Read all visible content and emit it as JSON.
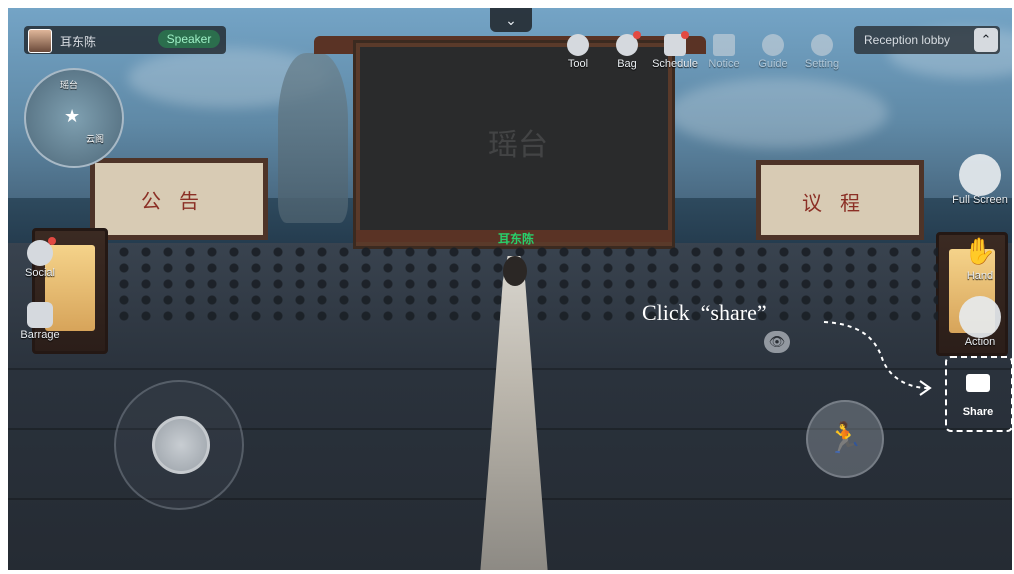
{
  "user": {
    "name": "耳东陈",
    "role_badge": "Speaker"
  },
  "top_menu": [
    {
      "label": "Tool",
      "icon": "tool-icon",
      "notify": false,
      "dim": false
    },
    {
      "label": "Bag",
      "icon": "bag-icon",
      "notify": true,
      "dim": false
    },
    {
      "label": "Schedule",
      "icon": "schedule-icon",
      "notify": true,
      "dim": false
    },
    {
      "label": "Notice",
      "icon": "notice-icon",
      "notify": false,
      "dim": true
    },
    {
      "label": "Guide",
      "icon": "guide-icon",
      "notify": false,
      "dim": true
    },
    {
      "label": "Setting",
      "icon": "gear-icon",
      "notify": false,
      "dim": true
    }
  ],
  "collapse_glyph": "⌄",
  "location": {
    "label": "Reception lobby",
    "button_glyph": "⌃"
  },
  "minimap": {
    "label_top": "瑶台",
    "label_right": "云阁"
  },
  "left_side": [
    {
      "label": "Social",
      "icon": "social-icon"
    },
    {
      "label": "Barrage",
      "icon": "barrage-icon"
    }
  ],
  "right_side": [
    {
      "label": "Full Screen",
      "icon": "full-screen-icon"
    },
    {
      "label": "Hand",
      "icon": "hand-icon"
    },
    {
      "label": "Action",
      "icon": "action-icon"
    },
    {
      "label": "Share",
      "icon": "share-icon"
    }
  ],
  "scene": {
    "stage_name": "耳东陈",
    "stage_logo": "瑶台",
    "left_board": "公告",
    "right_board": "议程"
  },
  "instruction": "Click  “share”",
  "colors": {
    "speaker_badge": "#2b6e4d",
    "stage_name": "#28d06b",
    "dashed_highlight": "#ffffff"
  }
}
